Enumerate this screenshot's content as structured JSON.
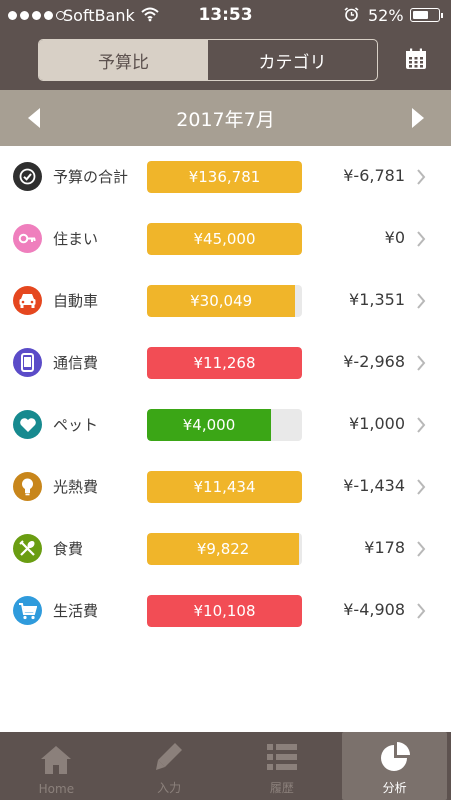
{
  "status_bar": {
    "carrier": "SoftBank",
    "time": "13:53",
    "battery": "52%",
    "signal_dots": 4,
    "signal_dots_total": 5
  },
  "header": {
    "tabs": [
      {
        "label": "予算比",
        "active": true
      },
      {
        "label": "カテゴリ",
        "active": false
      }
    ],
    "calendar_icon": "calendar-icon"
  },
  "month_nav": {
    "label": "2017年7月"
  },
  "categories": [
    {
      "label": "予算の合計",
      "amount": "¥136,781",
      "remaining": "¥-6,781",
      "fill": 1.0,
      "bar_color": "#f0b52a",
      "icon": "check-icon",
      "icon_bg": "#2f2f2f"
    },
    {
      "label": "住まい",
      "amount": "¥45,000",
      "remaining": "¥0",
      "fill": 1.0,
      "bar_color": "#f0b52a",
      "icon": "key-icon",
      "icon_bg": "#ef7fbd"
    },
    {
      "label": "自動車",
      "amount": "¥30,049",
      "remaining": "¥1,351",
      "fill": 0.957,
      "bar_color": "#f0b52a",
      "icon": "car-icon",
      "icon_bg": "#e5471f"
    },
    {
      "label": "通信費",
      "amount": "¥11,268",
      "remaining": "¥-2,968",
      "fill": 1.0,
      "bar_color": "#f24d55",
      "icon": "phone-icon",
      "icon_bg": "#5b4cc8"
    },
    {
      "label": "ペット",
      "amount": "¥4,000",
      "remaining": "¥1,000",
      "fill": 0.8,
      "bar_color": "#3ba616",
      "icon": "heart-icon",
      "icon_bg": "#178a8f"
    },
    {
      "label": "光熱費",
      "amount": "¥11,434",
      "remaining": "¥-1,434",
      "fill": 1.0,
      "bar_color": "#f0b52a",
      "icon": "bulb-icon",
      "icon_bg": "#c8861b"
    },
    {
      "label": "食費",
      "amount": "¥9,822",
      "remaining": "¥178",
      "fill": 0.982,
      "bar_color": "#f0b52a",
      "icon": "fork-spoon-icon",
      "icon_bg": "#6a9d12"
    },
    {
      "label": "生活費",
      "amount": "¥10,108",
      "remaining": "¥-4,908",
      "fill": 1.0,
      "bar_color": "#f24d55",
      "icon": "cart-icon",
      "icon_bg": "#2f9bdc"
    }
  ],
  "tab_bar": [
    {
      "label": "Home",
      "icon": "home-icon",
      "active": false
    },
    {
      "label": "入力",
      "icon": "pencil-icon",
      "active": false
    },
    {
      "label": "履歴",
      "icon": "list-icon",
      "active": false
    },
    {
      "label": "分析",
      "icon": "pie-chart-icon",
      "active": true
    }
  ]
}
